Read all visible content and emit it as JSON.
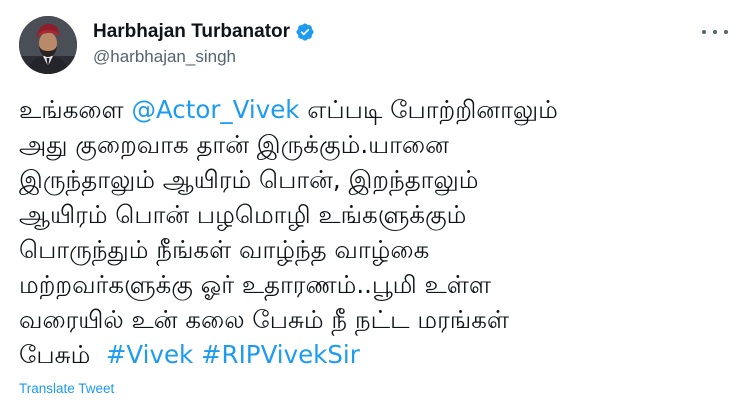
{
  "author": {
    "display_name": "Harbhajan Turbanator",
    "handle": "@harbhajan_singh",
    "verified": true
  },
  "icons": {
    "avatar": "profile-photo",
    "verified": "verified-badge-icon",
    "more": "more-options-icon"
  },
  "colors": {
    "link": "#1d9bf0",
    "text": "#0f1419",
    "secondary": "#536471"
  },
  "tweet": {
    "lines": [
      {
        "before": "உங்களை ",
        "mention": "@Actor_Vivek",
        "after": " எப்படி போற்றினாலும்"
      },
      {
        "text": "அது குறைவாக தான் இருக்கும்.யானை"
      },
      {
        "text": "இருந்தாலும் ஆயிரம் பொன், இறந்தாலும்"
      },
      {
        "text": "ஆயிரம் பொன் பழமொழி உங்களுக்கும்"
      },
      {
        "text": "பொருந்தும் நீங்கள் வாழ்ந்த வாழ்கை"
      },
      {
        "text": "மற்றவர்களுக்கு ஓர் உதாரணம்..பூமி உள்ள"
      },
      {
        "text": "வரையில் உன் கலை பேசும் நீ நட்ட மரங்கள்"
      },
      {
        "before": "பேசும்  ",
        "hashtag1": "#Vivek",
        "hashtag2": "#RIPVivekSir"
      }
    ]
  },
  "actions": {
    "translate_label": "Translate Tweet"
  }
}
